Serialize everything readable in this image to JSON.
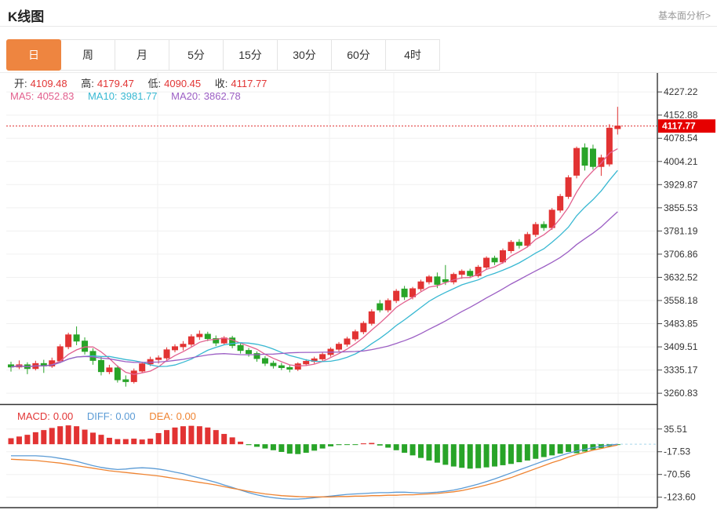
{
  "header": {
    "title": "K线图",
    "link": "基本面分析>"
  },
  "tabs": {
    "items": [
      {
        "label": "日",
        "active": true
      },
      {
        "label": "周",
        "active": false
      },
      {
        "label": "月",
        "active": false
      },
      {
        "label": "5分",
        "active": false
      },
      {
        "label": "15分",
        "active": false
      },
      {
        "label": "30分",
        "active": false
      },
      {
        "label": "60分",
        "active": false
      },
      {
        "label": "4时",
        "active": false
      }
    ]
  },
  "legend": {
    "open_label": "开:",
    "open": "4109.48",
    "high_label": "高:",
    "high": "4179.47",
    "low_label": "低:",
    "low": "4090.45",
    "close_label": "收:",
    "close": "4117.77",
    "ma5_label": "MA5:",
    "ma5": "4052.83",
    "ma10_label": "MA10:",
    "ma10": "3981.77",
    "ma20_label": "MA20:",
    "ma20": "3862.78"
  },
  "macd_legend": {
    "macd_label": "MACD:",
    "macd": "0.00",
    "diff_label": "DIFF:",
    "diff": "0.00",
    "dea_label": "DEA:",
    "dea": "0.00"
  },
  "colors": {
    "up_red": "#e23333",
    "down_green": "#28a428",
    "ma5": "#e2608e",
    "ma10": "#38b8d2",
    "ma20": "#9c5fc4",
    "diff_line": "#5b9bd5",
    "dea_line": "#ef8432",
    "price_tag": "#e60000",
    "price_line": "#e03131",
    "tab_active": "#ee8540",
    "axis_text": "#333333",
    "value_red": "#e23535",
    "link_gray": "#999999",
    "grid": "#f0f0f0",
    "zero_dash": "#a8d8ea"
  },
  "chart_data": [
    {
      "type": "candlestick",
      "title": "K线图 日K",
      "legend_position": "top-left",
      "grid": true,
      "ylim": [
        3226,
        4288
      ],
      "y_ticks": [
        4227.22,
        4152.88,
        4078.54,
        4004.21,
        3929.87,
        3855.53,
        3781.19,
        3706.86,
        3632.52,
        3558.18,
        3483.85,
        3409.51,
        3335.17,
        3260.83
      ],
      "x_gridlines": [
        201,
        420,
        502,
        683,
        788
      ],
      "price_line": 4117.77,
      "price_line_label": "4117.77",
      "ma_periods": [
        5,
        10,
        20
      ],
      "candles": [
        [
          3352,
          3362,
          3330,
          3345
        ],
        [
          3345,
          3366,
          3338,
          3352
        ],
        [
          3352,
          3360,
          3322,
          3340
        ],
        [
          3340,
          3365,
          3334,
          3356
        ],
        [
          3356,
          3368,
          3326,
          3348
        ],
        [
          3348,
          3375,
          3342,
          3365
        ],
        [
          3365,
          3418,
          3358,
          3410
        ],
        [
          3410,
          3455,
          3402,
          3448
        ],
        [
          3448,
          3475,
          3415,
          3428
        ],
        [
          3428,
          3440,
          3385,
          3395
        ],
        [
          3395,
          3405,
          3352,
          3366
        ],
        [
          3366,
          3378,
          3318,
          3330
        ],
        [
          3330,
          3352,
          3322,
          3342
        ],
        [
          3342,
          3350,
          3295,
          3304
        ],
        [
          3304,
          3318,
          3282,
          3298
        ],
        [
          3298,
          3340,
          3292,
          3332
        ],
        [
          3332,
          3362,
          3326,
          3355
        ],
        [
          3355,
          3378,
          3348,
          3369
        ],
        [
          3369,
          3382,
          3356,
          3374
        ],
        [
          3374,
          3408,
          3368,
          3400
        ],
        [
          3400,
          3418,
          3392,
          3410
        ],
        [
          3410,
          3428,
          3398,
          3418
        ],
        [
          3418,
          3450,
          3410,
          3442
        ],
        [
          3442,
          3462,
          3432,
          3450
        ],
        [
          3450,
          3458,
          3428,
          3436
        ],
        [
          3436,
          3446,
          3412,
          3422
        ],
        [
          3422,
          3444,
          3415,
          3438
        ],
        [
          3438,
          3445,
          3405,
          3414
        ],
        [
          3414,
          3422,
          3388,
          3398
        ],
        [
          3398,
          3406,
          3378,
          3388
        ],
        [
          3388,
          3395,
          3362,
          3372
        ],
        [
          3372,
          3380,
          3348,
          3357
        ],
        [
          3357,
          3365,
          3340,
          3349
        ],
        [
          3349,
          3358,
          3335,
          3343
        ],
        [
          3343,
          3352,
          3328,
          3338
        ],
        [
          3338,
          3360,
          3332,
          3355
        ],
        [
          3355,
          3370,
          3348,
          3363
        ],
        [
          3363,
          3378,
          3356,
          3371
        ],
        [
          3371,
          3392,
          3364,
          3385
        ],
        [
          3385,
          3408,
          3378,
          3402
        ],
        [
          3402,
          3425,
          3395,
          3418
        ],
        [
          3418,
          3442,
          3410,
          3435
        ],
        [
          3435,
          3465,
          3428,
          3458
        ],
        [
          3458,
          3492,
          3450,
          3485
        ],
        [
          3485,
          3530,
          3478,
          3522
        ],
        [
          3548,
          3560,
          3520,
          3528
        ],
        [
          3528,
          3565,
          3520,
          3558
        ],
        [
          3558,
          3595,
          3550,
          3588
        ],
        [
          3595,
          3605,
          3560,
          3570
        ],
        [
          3570,
          3602,
          3562,
          3596
        ],
        [
          3596,
          3625,
          3588,
          3618
        ],
        [
          3618,
          3640,
          3610,
          3634
        ],
        [
          3634,
          3648,
          3598,
          3610
        ],
        [
          3625,
          3672,
          3608,
          3618
        ],
        [
          3618,
          3648,
          3610,
          3642
        ],
        [
          3642,
          3658,
          3628,
          3652
        ],
        [
          3652,
          3660,
          3630,
          3638
        ],
        [
          3638,
          3672,
          3632,
          3665
        ],
        [
          3665,
          3700,
          3658,
          3694
        ],
        [
          3694,
          3702,
          3672,
          3682
        ],
        [
          3682,
          3725,
          3676,
          3718
        ],
        [
          3718,
          3752,
          3710,
          3745
        ],
        [
          3745,
          3755,
          3725,
          3735
        ],
        [
          3735,
          3778,
          3728,
          3770
        ],
        [
          3770,
          3810,
          3762,
          3802
        ],
        [
          3802,
          3812,
          3782,
          3792
        ],
        [
          3792,
          3855,
          3785,
          3848
        ],
        [
          3848,
          3900,
          3840,
          3892
        ],
        [
          3892,
          3960,
          3884,
          3952
        ],
        [
          3960,
          4052,
          3950,
          4046
        ],
        [
          4048,
          4062,
          3975,
          3992
        ],
        [
          4044,
          4058,
          3978,
          3988
        ],
        [
          3988,
          4026,
          3958,
          4016
        ],
        [
          3996,
          4124,
          3988,
          4111
        ],
        [
          4109.48,
          4179.47,
          4090.45,
          4117.77
        ]
      ]
    },
    {
      "type": "bar+line",
      "title": "MACD",
      "ylim": [
        -148,
        90
      ],
      "y_ticks": [
        35.51,
        -17.53,
        -70.56,
        -123.6
      ],
      "zero_line": 0,
      "histogram": [
        14,
        18,
        22,
        28,
        33,
        38,
        42,
        44,
        42,
        34,
        27,
        22,
        15,
        12,
        12,
        13,
        11,
        13,
        26,
        33,
        39,
        42,
        43,
        42,
        39,
        33,
        24,
        16,
        6,
        -2,
        -6,
        -10,
        -14,
        -18,
        -22,
        -23,
        -20,
        -15,
        -10,
        -5,
        -2,
        -1,
        -1,
        2,
        3,
        -3,
        -8,
        -14,
        -20,
        -26,
        -32,
        -38,
        -43,
        -48,
        -52,
        -55,
        -57,
        -56,
        -54,
        -52,
        -49,
        -46,
        -42,
        -38,
        -34,
        -30,
        -26,
        -22,
        -18,
        -21,
        -17,
        -13,
        -9,
        -5,
        -1
      ],
      "series": [
        {
          "name": "DIFF",
          "values": [
            -27,
            -27,
            -27,
            -27,
            -28,
            -30,
            -33,
            -36,
            -40,
            -45,
            -50,
            -54,
            -57,
            -59,
            -58,
            -56,
            -55,
            -56,
            -58,
            -61,
            -65,
            -69,
            -74,
            -79,
            -84,
            -89,
            -95,
            -101,
            -107,
            -113,
            -118,
            -122,
            -125,
            -127,
            -128,
            -128,
            -127,
            -125,
            -123,
            -121,
            -119,
            -117,
            -116,
            -115,
            -114,
            -113,
            -113,
            -112,
            -112,
            -113,
            -114,
            -113,
            -112,
            -110,
            -107,
            -103,
            -98,
            -93,
            -87,
            -81,
            -74,
            -67,
            -60,
            -53,
            -46,
            -39,
            -33,
            -27,
            -21,
            -16,
            -12,
            -8,
            -5,
            -2,
            0
          ]
        },
        {
          "name": "DEA",
          "values": [
            -35,
            -36,
            -37,
            -38,
            -40,
            -42,
            -44,
            -47,
            -50,
            -53,
            -56,
            -59,
            -62,
            -64,
            -66,
            -68,
            -70,
            -72,
            -74,
            -77,
            -80,
            -83,
            -86,
            -89,
            -92,
            -95,
            -99,
            -103,
            -106,
            -110,
            -113,
            -116,
            -118,
            -120,
            -121,
            -122,
            -123,
            -123,
            -123,
            -123,
            -122,
            -122,
            -121,
            -121,
            -120,
            -120,
            -119,
            -119,
            -118,
            -118,
            -117,
            -116,
            -115,
            -113,
            -111,
            -108,
            -104,
            -100,
            -95,
            -90,
            -84,
            -78,
            -71,
            -64,
            -57,
            -50,
            -43,
            -37,
            -30,
            -24,
            -19,
            -14,
            -10,
            -6,
            -2
          ]
        }
      ]
    }
  ]
}
